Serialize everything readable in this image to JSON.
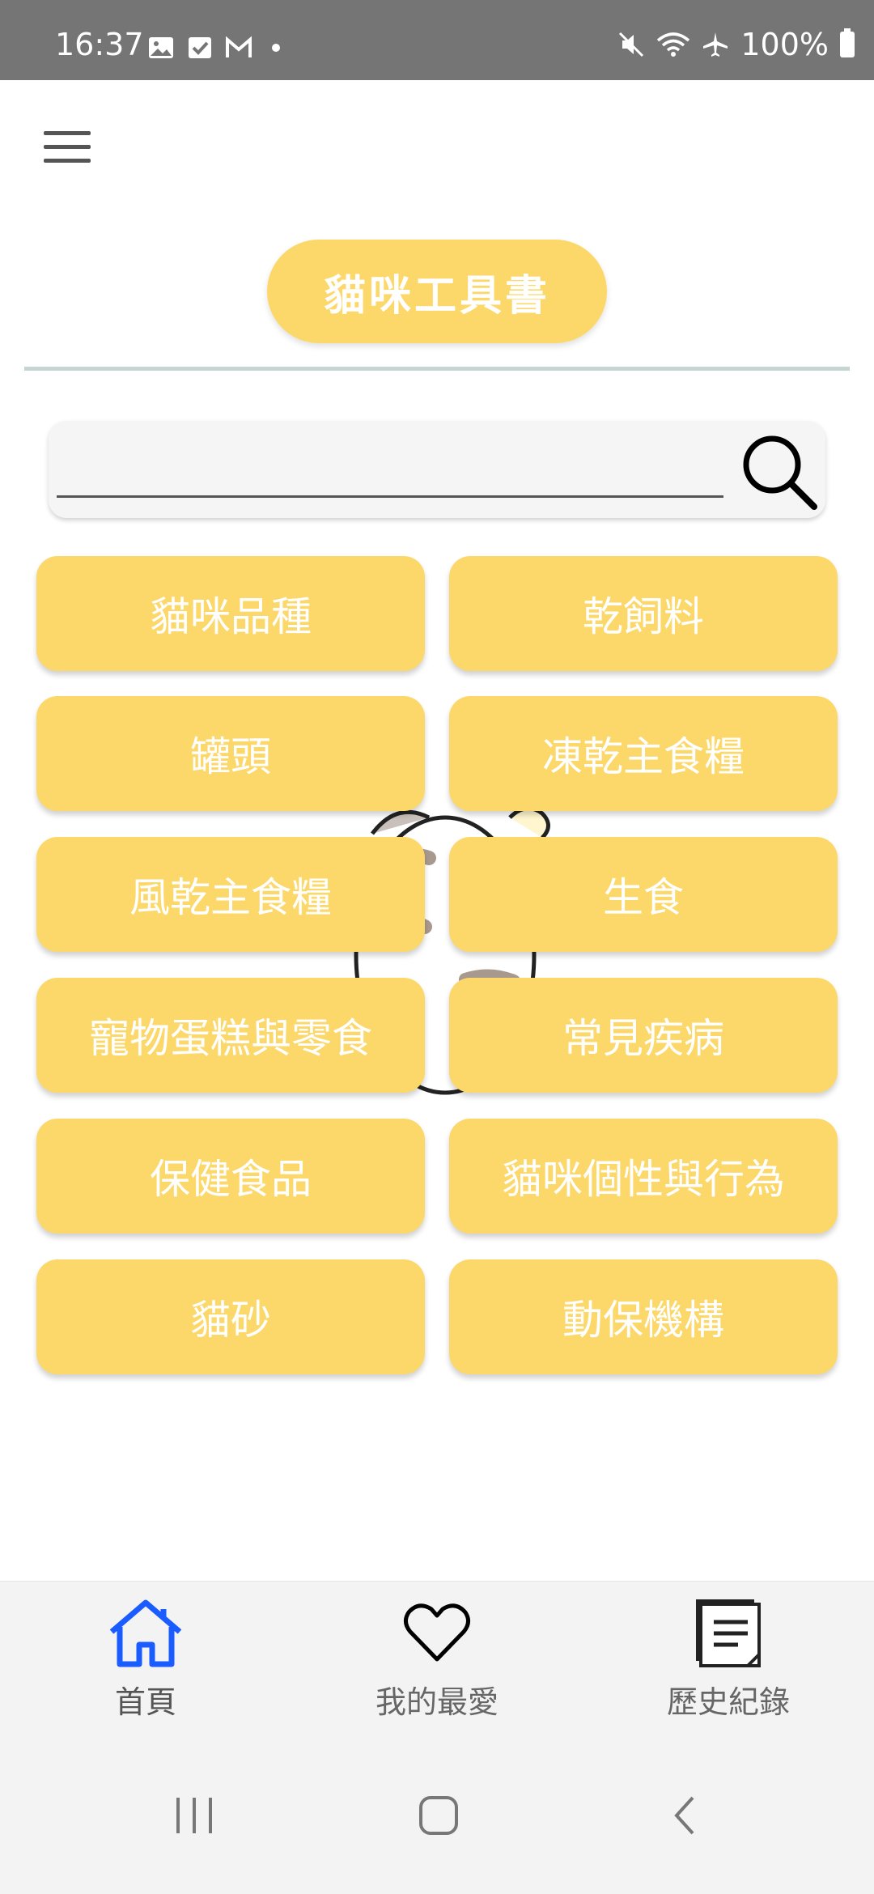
{
  "status_bar": {
    "time": "16:37",
    "battery": "100%",
    "icons_left": [
      "image-icon",
      "checkbox-icon",
      "gmail-icon",
      "dot-icon"
    ],
    "icons_right": [
      "mute-icon",
      "wifi-icon",
      "airplane-icon",
      "battery-icon"
    ]
  },
  "app": {
    "menu_icon": "hamburger-menu-icon",
    "title": "貓咪工具書"
  },
  "search": {
    "value": "",
    "placeholder": "",
    "icon": "search-icon"
  },
  "categories": [
    "貓咪品種",
    "乾飼料",
    "罐頭",
    "凍乾主食糧",
    "風乾主食糧",
    "生食",
    "寵物蛋糕與零食",
    "常見疾病",
    "保健食品",
    "貓咪個性與行為",
    "貓砂",
    "動保機構"
  ],
  "bottom_nav": {
    "items": [
      {
        "label": "首頁",
        "icon": "home-icon",
        "active": true
      },
      {
        "label": "我的最愛",
        "icon": "heart-icon",
        "active": false
      },
      {
        "label": "歷史紀錄",
        "icon": "history-documents-icon",
        "active": false
      }
    ]
  },
  "colors": {
    "accent": "#fcd86b",
    "status_bar": "#757575",
    "active_nav": "#1a5cff",
    "divider": "#c5d6d2"
  }
}
